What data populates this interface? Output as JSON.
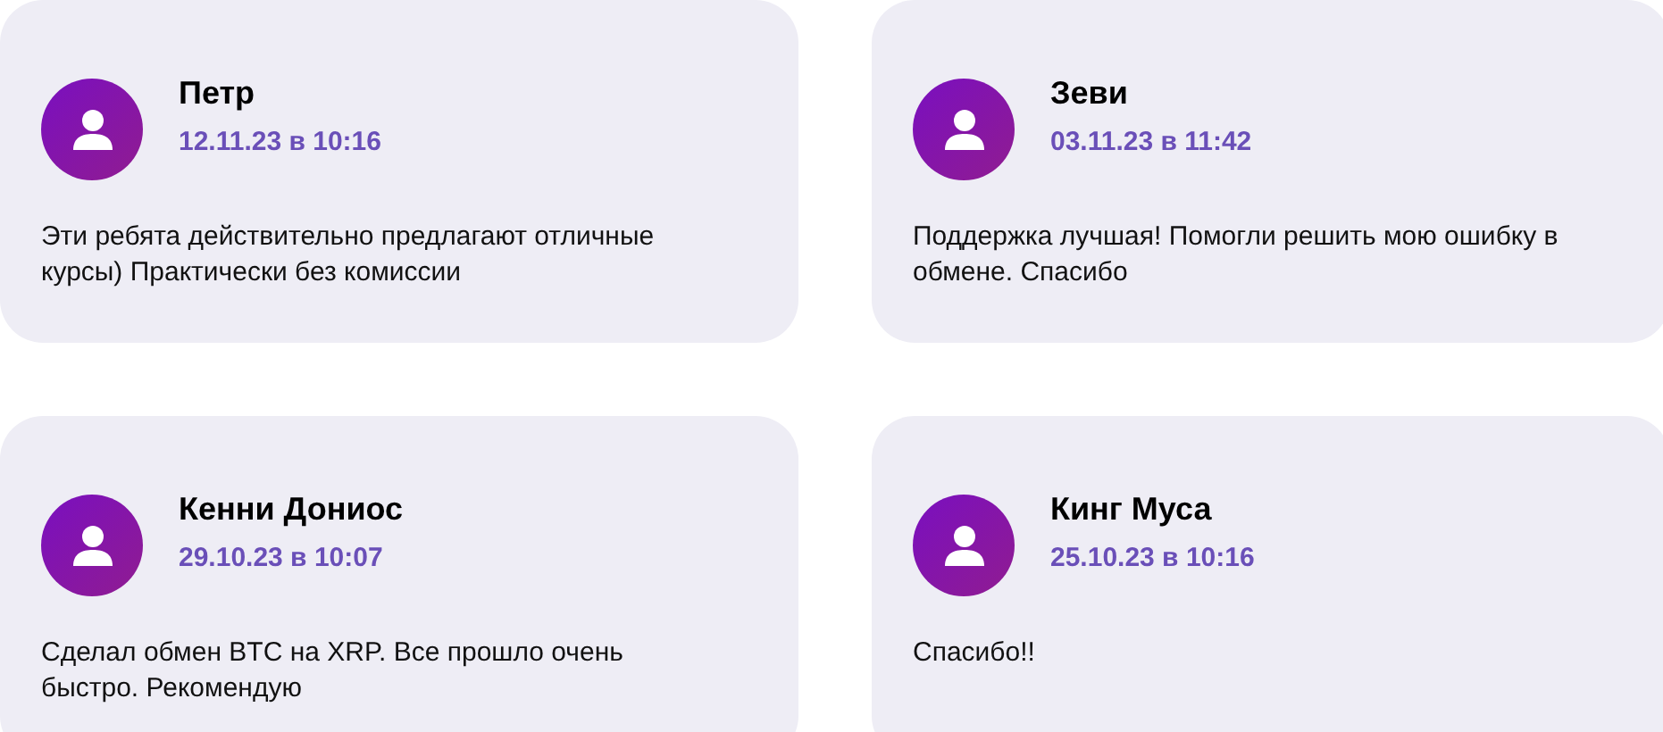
{
  "reviews": [
    {
      "name": "Петр",
      "date": "12.11.23 в 10:16",
      "text": "Эти ребята действительно предлагают отличные курсы) Практически без комиссии"
    },
    {
      "name": "Зеви",
      "date": "03.11.23 в 11:42",
      "text": "Поддержка лучшая! Помогли решить мою ошибку в обмене. Спасибо"
    },
    {
      "name": "Кенни Дониос",
      "date": "29.10.23 в 10:07",
      "text": "Сделал обмен BTC на XRP. Все прошло очень быстро. Рекомендую"
    },
    {
      "name": "Кинг Муса",
      "date": "25.10.23 в 10:16",
      "text": "Спасибо!!"
    }
  ]
}
